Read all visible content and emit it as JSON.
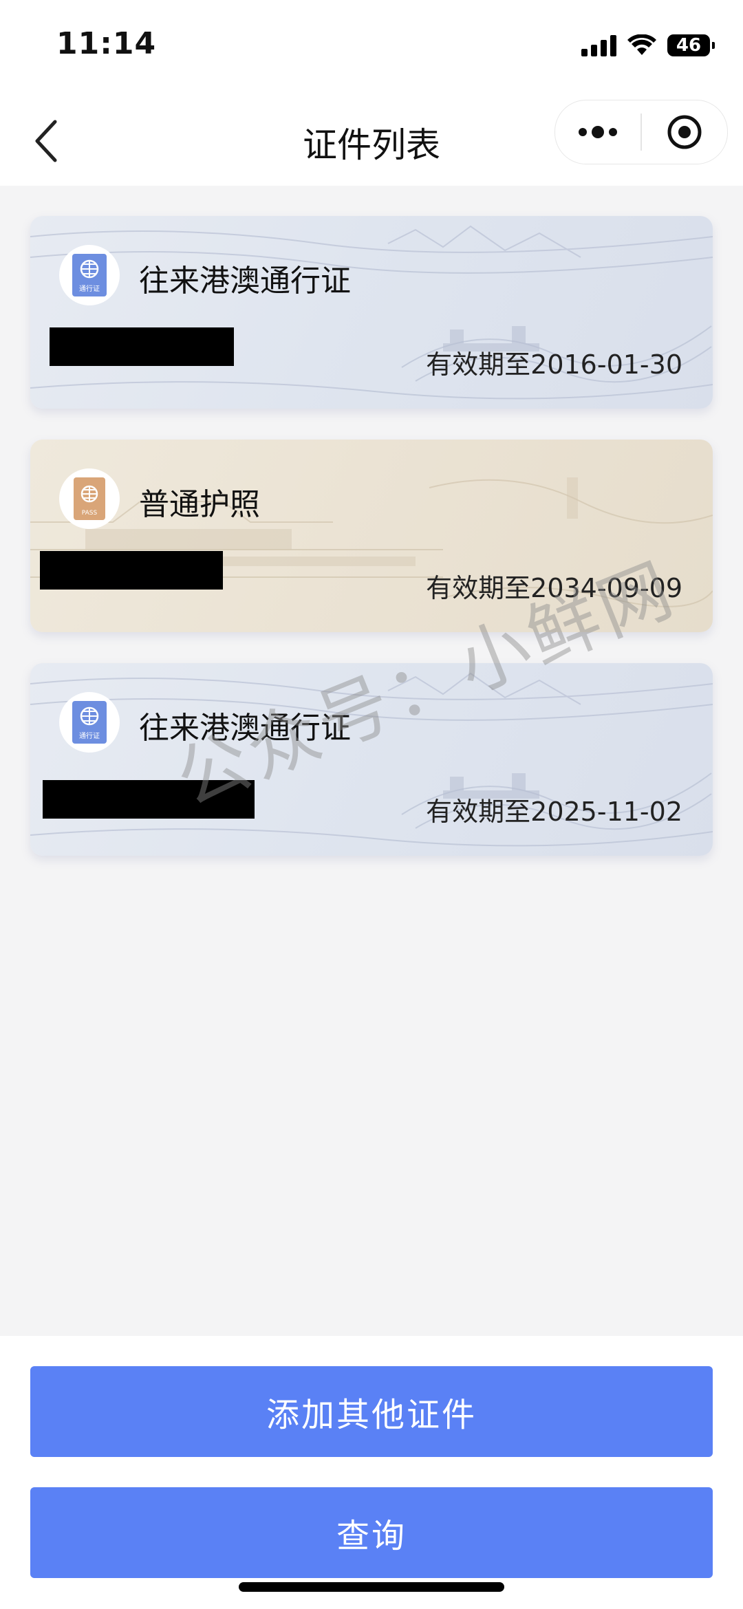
{
  "status_bar": {
    "time": "11:14",
    "battery": "46"
  },
  "nav": {
    "title": "证件列表"
  },
  "cards": [
    {
      "type_name": "往来港澳通行证",
      "icon_label": "通行证",
      "expiry": "有效期至2016-01-30",
      "theme": "blue"
    },
    {
      "type_name": "普通护照",
      "icon_label": "PASS",
      "expiry": "有效期至2034-09-09",
      "theme": "beige"
    },
    {
      "type_name": "往来港澳通行证",
      "icon_label": "通行证",
      "expiry": "有效期至2025-11-02",
      "theme": "blue"
    }
  ],
  "watermark": "公众号：小鲜网",
  "buttons": {
    "add_other": "添加其他证件",
    "query": "查询"
  },
  "colors": {
    "primary_button": "#5a81f5",
    "permit_icon": "#6d8ee0",
    "passport_icon": "#d9a578"
  }
}
